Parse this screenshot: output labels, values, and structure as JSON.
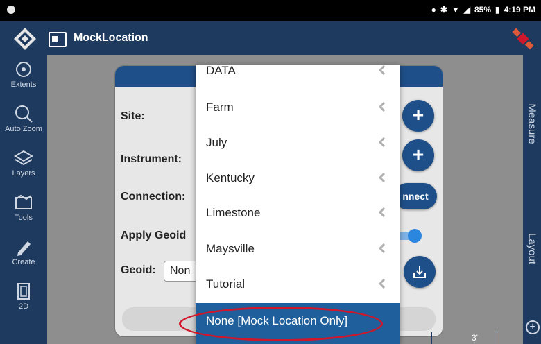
{
  "status": {
    "battery": "85%",
    "time": "4:19 PM"
  },
  "app": {
    "title": "MockLocation"
  },
  "toolbar": {
    "items": [
      {
        "label": "Extents",
        "icon": "extents-icon"
      },
      {
        "label": "Auto Zoom",
        "icon": "auto-zoom-icon"
      },
      {
        "label": "Layers",
        "icon": "layers-icon"
      },
      {
        "label": "Tools",
        "icon": "tools-icon"
      },
      {
        "label": "Create",
        "icon": "pencil-icon"
      },
      {
        "label": "2D",
        "icon": "2d-icon"
      }
    ]
  },
  "rightbar": {
    "measure": "Measure",
    "layout": "Layout"
  },
  "dialog": {
    "site_label": "Site:",
    "instrument_label": "Instrument:",
    "connection_label": "Connection:",
    "apply_geoid_label": "Apply Geoid",
    "geoid_label": "Geoid:",
    "geoid_value": "Non",
    "connect_label": "nnect"
  },
  "dropdown": {
    "items": [
      "DATA",
      "Farm",
      "July",
      "Kentucky",
      "Limestone",
      "Maysville",
      "Tutorial"
    ],
    "selected": "None [Mock Location Only]"
  },
  "map": {
    "scale_label": "3'"
  },
  "colors": {
    "appbar": "#1f3a5f",
    "accent": "#1f4f88",
    "selected": "#1f5f9c",
    "highlight_ellipse": "#d0162a"
  }
}
